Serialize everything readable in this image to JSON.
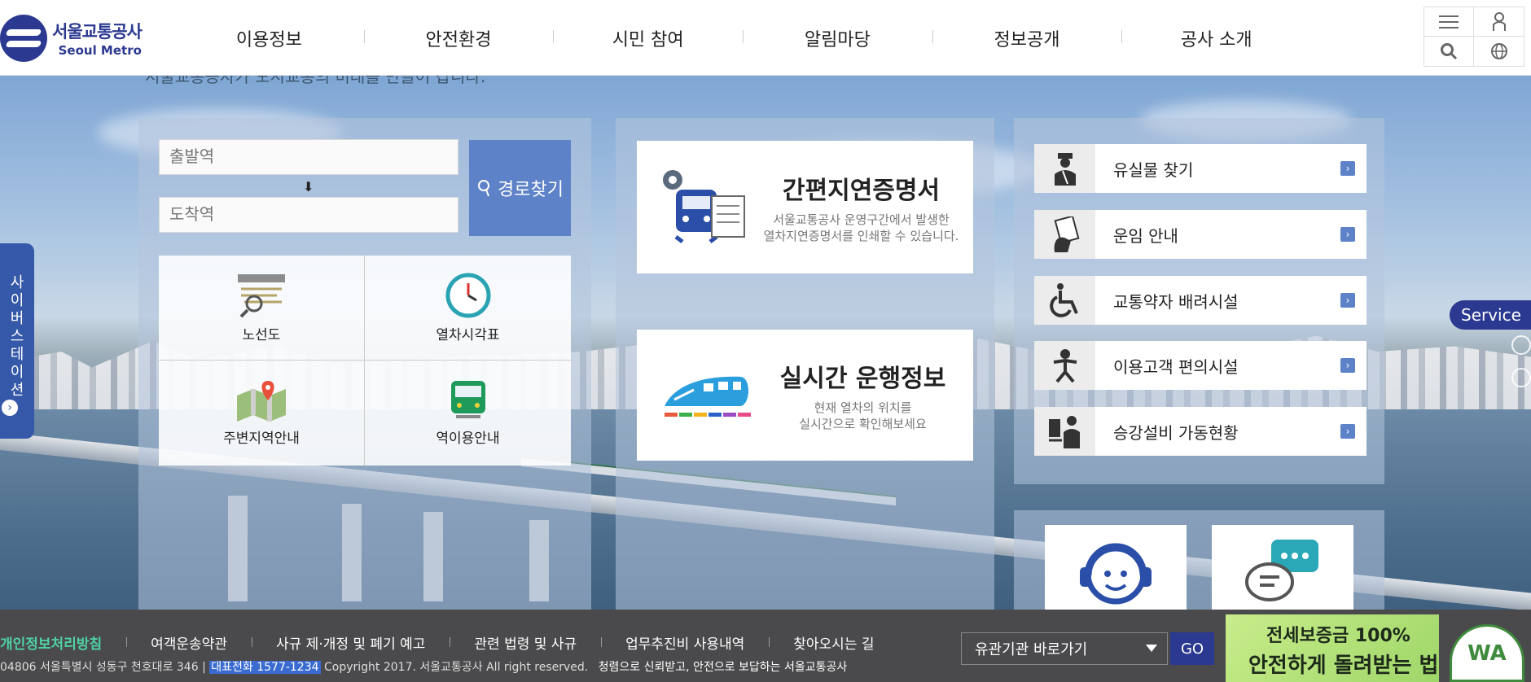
{
  "header": {
    "logo": {
      "ko": "서울교통공사",
      "en": "Seoul Metro"
    },
    "nav": [
      "이용정보",
      "안전환경",
      "시민 참여",
      "알림마당",
      "정보공개",
      "공사 소개"
    ],
    "util_icons": [
      "menu-icon",
      "user-icon",
      "search-icon",
      "globe-icon"
    ]
  },
  "behind_text": "서울교통공사가 도시교통의 미래를 만들어 갑니다.",
  "route": {
    "departure_placeholder": "출발역",
    "arrival_placeholder": "도착역",
    "search_label": "경로찾기"
  },
  "quick_menu": [
    {
      "label": "노선도",
      "icon": "route-map-icon"
    },
    {
      "label": "열차시각표",
      "icon": "clock-icon"
    },
    {
      "label": "주변지역안내",
      "icon": "map-pin-icon"
    },
    {
      "label": "역이용안내",
      "icon": "train-front-icon"
    }
  ],
  "cards": [
    {
      "title": "간편지연증명서",
      "desc1": "서울교통공사 운영구간에서 발생한",
      "desc2": "열차지연증명서를 인쇄할 수 있습니다."
    },
    {
      "title": "실시간 운행정보",
      "desc1": "현재 열차의 위치를",
      "desc2": "실시간으로 확인해보세요"
    }
  ],
  "services": [
    {
      "label": "유실물 찾기",
      "icon": "officer-icon"
    },
    {
      "label": "운임 안내",
      "icon": "ticket-icon"
    },
    {
      "label": "교통약자 배려시설",
      "icon": "wheelchair-icon"
    },
    {
      "label": "이용고객 편의시설",
      "icon": "baby-icon"
    },
    {
      "label": "승강설비 가동현황",
      "icon": "elevator-icon"
    }
  ],
  "bottom_cards": [
    {
      "icon": "headset-icon"
    },
    {
      "icon": "chat-icon"
    }
  ],
  "side": {
    "cyber_label": "사이버스테이션",
    "service_label": "Service"
  },
  "footer": {
    "links": [
      "개인정보처리방침",
      "여객운송약관",
      "사규 제·개정 및 폐기 예고",
      "관련 법령 및 사규",
      "업무추진비 사용내역",
      "찾아오시는 길"
    ],
    "address": "04806 서울특별시 성동구 천호대로 346 |",
    "tel": "대표전화 1577-1234",
    "copyright": "Copyright 2017. 서울교통공사 All right reserved.",
    "slogan": "청렴으로 신뢰받고, 안전으로 보답하는 서울교통공사",
    "select_label": "유관기관 바로가기",
    "go_label": "GO",
    "banner_line1": "전세보증금 100%",
    "banner_line2": "안전하게 돌려받는 법",
    "wa_label": "WA"
  },
  "colors": {
    "brand": "#2b3990",
    "accent": "#5e82c8",
    "footer_bg": "#4a4a4c",
    "privacy_link": "#4fd1a5"
  }
}
